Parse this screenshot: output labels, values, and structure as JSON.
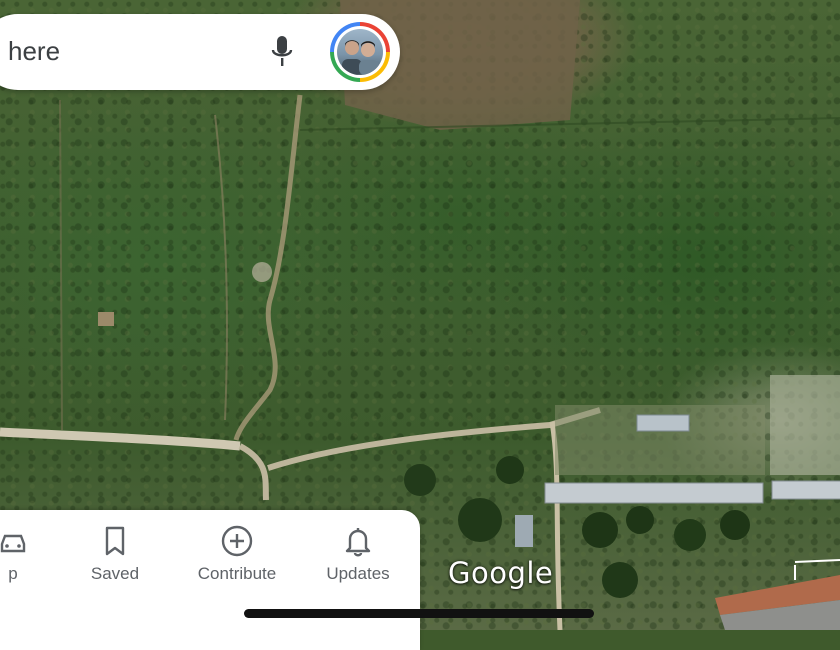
{
  "search": {
    "placeholder_fragment": "here"
  },
  "account": {
    "avatar_label": "profile-avatar"
  },
  "bottom_nav": {
    "items": [
      {
        "label": "p",
        "icon": "car-icon"
      },
      {
        "label": "Saved",
        "icon": "bookmark-icon"
      },
      {
        "label": "Contribute",
        "icon": "add-circle-icon"
      },
      {
        "label": "Updates",
        "icon": "bell-icon"
      }
    ]
  },
  "map": {
    "attribution": "Google",
    "view": "satellite"
  },
  "colors": {
    "ring_red": "#ea4335",
    "ring_yellow": "#fbbc05",
    "ring_green": "#34a853",
    "ring_blue": "#4285f4",
    "icon_gray": "#5f6368"
  }
}
